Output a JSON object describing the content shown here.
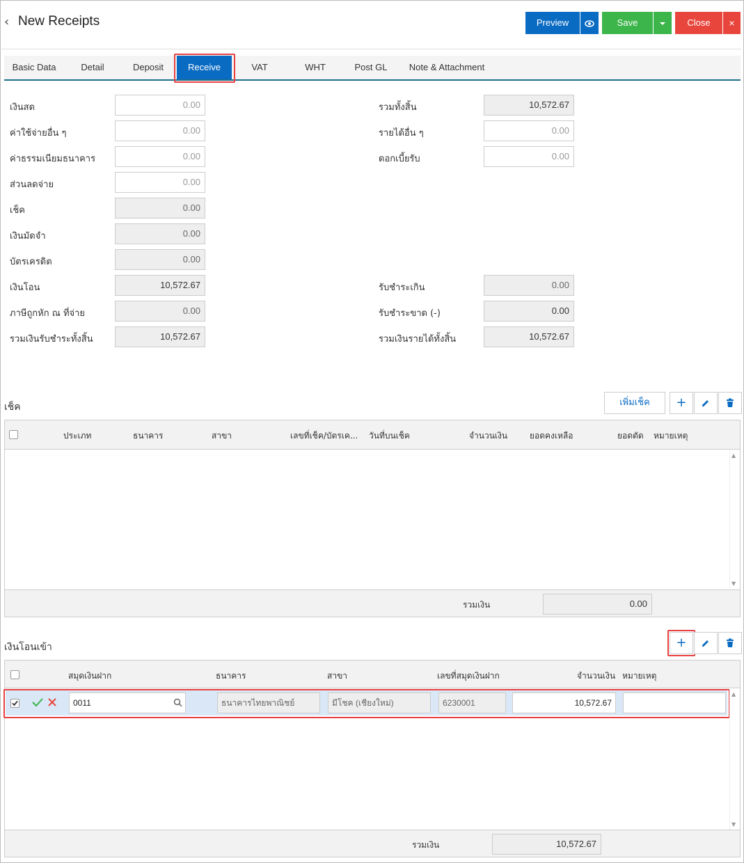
{
  "header": {
    "title": "New Receipts",
    "preview_label": "Preview",
    "save_label": "Save",
    "close_label": "Close"
  },
  "tabs": [
    {
      "label": "Basic Data"
    },
    {
      "label": "Detail"
    },
    {
      "label": "Deposit"
    },
    {
      "label": "Receive",
      "active": true
    },
    {
      "label": "VAT"
    },
    {
      "label": "WHT"
    },
    {
      "label": "Post GL"
    },
    {
      "label": "Note & Attachment"
    }
  ],
  "form": {
    "left": [
      {
        "label": "เงินสด",
        "value": "0.00"
      },
      {
        "label": "ค่าใช้จ่ายอื่น ๆ",
        "value": "0.00"
      },
      {
        "label": "ค่าธรรมเนียมธนาคาร",
        "value": "0.00"
      },
      {
        "label": "ส่วนลดจ่าย",
        "value": "0.00"
      },
      {
        "label": "เช็ค",
        "value": "0.00"
      },
      {
        "label": "เงินมัดจำ",
        "value": "0.00"
      },
      {
        "label": "บัตรเครดิต",
        "value": "0.00"
      },
      {
        "label": "เงินโอน",
        "value": "10,572.67"
      },
      {
        "label": "ภาษีถูกหัก ณ ที่จ่าย",
        "value": "0.00"
      },
      {
        "label": "รวมเงินรับชำระทั้งสิ้น",
        "value": "10,572.67"
      }
    ],
    "right_top": [
      {
        "label": "รวมทั้งสิ้น",
        "value": "10,572.67"
      },
      {
        "label": "รายได้อื่น ๆ",
        "value": "0.00"
      },
      {
        "label": "ดอกเบี้ยรับ",
        "value": "0.00"
      }
    ],
    "right_bottom": [
      {
        "label": "รับชำระเกิน",
        "value": "0.00"
      },
      {
        "label": "รับชำระขาด (-)",
        "value": "0.00"
      },
      {
        "label": "รวมเงินรายได้ทั้งสิ้น",
        "value": "10,572.67"
      }
    ]
  },
  "cheque": {
    "title": "เช็ค",
    "add_cheque_label": "เพิ่มเช็ค",
    "columns": [
      "ประเภท",
      "ธนาคาร",
      "สาขา",
      "เลขที่เช็ค/บัตรเค...",
      "วันที่บนเช็ค",
      "จำนวนเงิน",
      "ยอดคงเหลือ",
      "ยอดตัด",
      "หมายเหตุ"
    ],
    "total_label": "รวมเงิน",
    "total_value": "0.00"
  },
  "transfer": {
    "title": "เงินโอนเข้า",
    "columns": [
      "สมุดเงินฝาก",
      "ธนาคาร",
      "สาขา",
      "เลขที่สมุดเงินฝาก",
      "จำนวนเงิน",
      "หมายเหตุ"
    ],
    "row": {
      "account": "0011",
      "bank": "ธนาคารไทยพาณิชย์",
      "branch": "มีโชค (เชียงใหม่)",
      "account_no": "6230001",
      "amount": "10,572.67",
      "note": ""
    },
    "total_label": "รวมเงิน",
    "total_value": "10,572.67"
  },
  "colors": {
    "primary": "#0a6bc2",
    "save": "#3cb54a",
    "close": "#e8463c",
    "highlight": "#e84040"
  }
}
